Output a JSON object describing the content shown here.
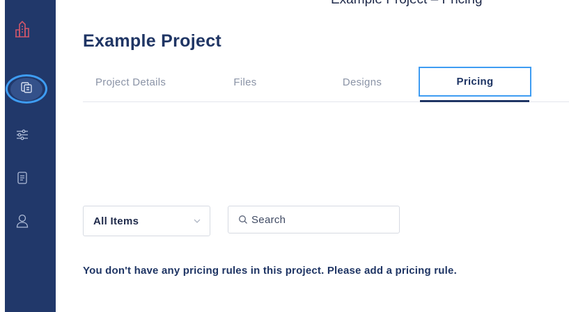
{
  "top_clipped_text": "Example Project – Pricing",
  "page_title": "Example Project",
  "tabs": [
    {
      "label": "Project Details",
      "active": false
    },
    {
      "label": "Files",
      "active": false
    },
    {
      "label": "Designs",
      "active": false
    },
    {
      "label": "Pricing",
      "active": true
    }
  ],
  "filters": {
    "items_select": {
      "selected": "All Items"
    },
    "search": {
      "placeholder": "Search",
      "value": ""
    }
  },
  "empty_message": "You don't have any pricing rules in this project. Please add a pricing rule.",
  "sidebar": {
    "items": [
      {
        "icon": "buildings-logo-icon"
      },
      {
        "icon": "projects-icon",
        "active": true
      },
      {
        "icon": "sliders-icon"
      },
      {
        "icon": "document-icon"
      },
      {
        "icon": "user-icon"
      }
    ]
  },
  "colors": {
    "sidebar_bg": "#21386a",
    "accent": "#3e9cf2",
    "title": "#1f3564",
    "logo": "#d0566a"
  }
}
